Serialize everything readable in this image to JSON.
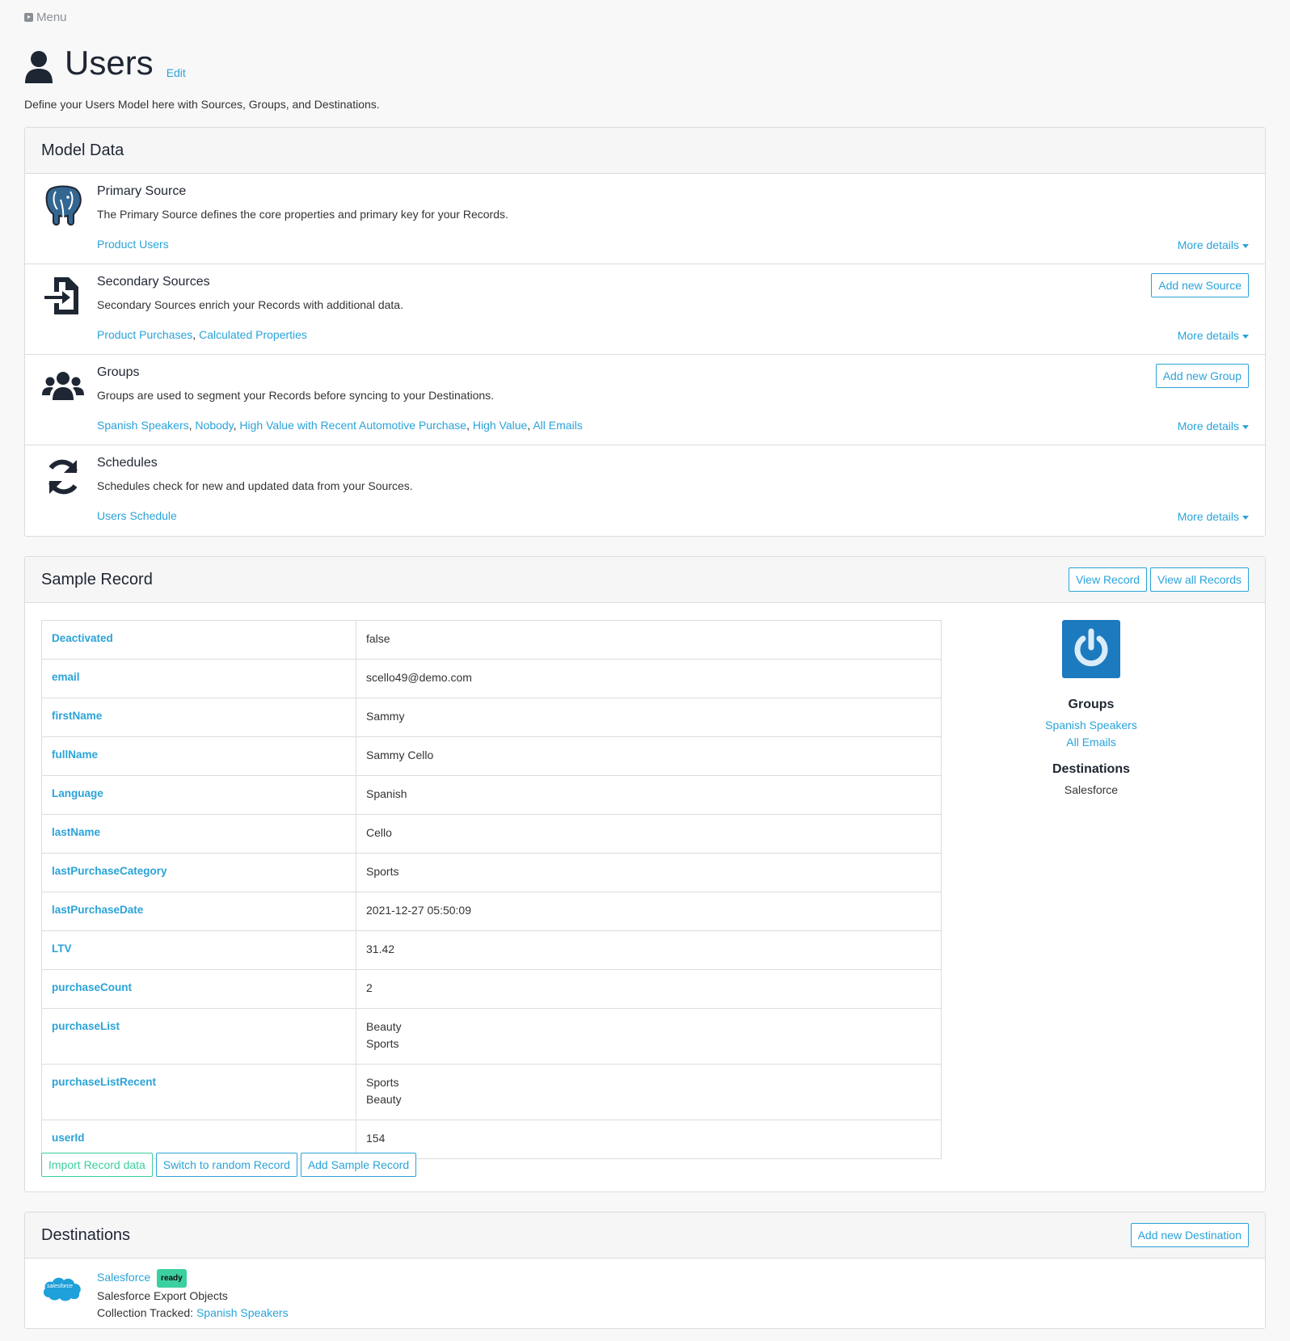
{
  "nav": {
    "menu_label": "Menu"
  },
  "page": {
    "title": "Users",
    "edit_label": "Edit",
    "subtitle": "Define your Users Model here with Sources, Groups, and Destinations."
  },
  "model_data": {
    "heading": "Model Data",
    "more_details": "More details",
    "primary": {
      "title": "Primary Source",
      "description": "The Primary Source defines the core properties and primary key for your Records.",
      "links": [
        "Product Users"
      ]
    },
    "secondary": {
      "title": "Secondary Sources",
      "description": "Secondary Sources enrich your Records with additional data.",
      "button": "Add new Source",
      "links": [
        "Product Purchases",
        "Calculated Properties"
      ]
    },
    "groups": {
      "title": "Groups",
      "description": "Groups are used to segment your Records before syncing to your Destinations.",
      "button": "Add new Group",
      "links": [
        "Spanish Speakers",
        "Nobody",
        "High Value with Recent Automotive Purchase",
        "High Value",
        "All Emails"
      ]
    },
    "schedules": {
      "title": "Schedules",
      "description": "Schedules check for new and updated data from your Sources.",
      "links": [
        "Users Schedule"
      ]
    }
  },
  "sample_record": {
    "heading": "Sample Record",
    "view_record": "View Record",
    "view_all": "View all Records",
    "rows": [
      {
        "key": "Deactivated",
        "value": "false"
      },
      {
        "key": "email",
        "value": "scello49@demo.com"
      },
      {
        "key": "firstName",
        "value": "Sammy"
      },
      {
        "key": "fullName",
        "value": "Sammy Cello"
      },
      {
        "key": "Language",
        "value": "Spanish"
      },
      {
        "key": "lastName",
        "value": "Cello"
      },
      {
        "key": "lastPurchaseCategory",
        "value": "Sports"
      },
      {
        "key": "lastPurchaseDate",
        "value": "2021-12-27 05:50:09"
      },
      {
        "key": "LTV",
        "value": "31.42"
      },
      {
        "key": "purchaseCount",
        "value": "2"
      },
      {
        "key": "purchaseList",
        "value": "Beauty",
        "value2": "Sports"
      },
      {
        "key": "purchaseListRecent",
        "value": "Sports",
        "value2": "Beauty"
      },
      {
        "key": "userId",
        "value": "154"
      }
    ],
    "buttons": {
      "import": "Import Record data",
      "random": "Switch to random Record",
      "add": "Add Sample Record"
    },
    "side": {
      "groups_heading": "Groups",
      "groups": [
        "Spanish Speakers",
        "All Emails"
      ],
      "destinations_heading": "Destinations",
      "destinations": [
        "Salesforce"
      ]
    }
  },
  "destinations": {
    "heading": "Destinations",
    "button": "Add new Destination",
    "item": {
      "name": "Salesforce",
      "badge": "ready",
      "description": "Salesforce Export Objects",
      "collection_label": "Collection Tracked: ",
      "collection_link": "Spanish Speakers",
      "logo_text": "salesforce"
    }
  },
  "colors": {
    "accent": "#2aa3d8",
    "ready": "#3ccf9f",
    "power_icon_bg": "#1c7abf"
  }
}
